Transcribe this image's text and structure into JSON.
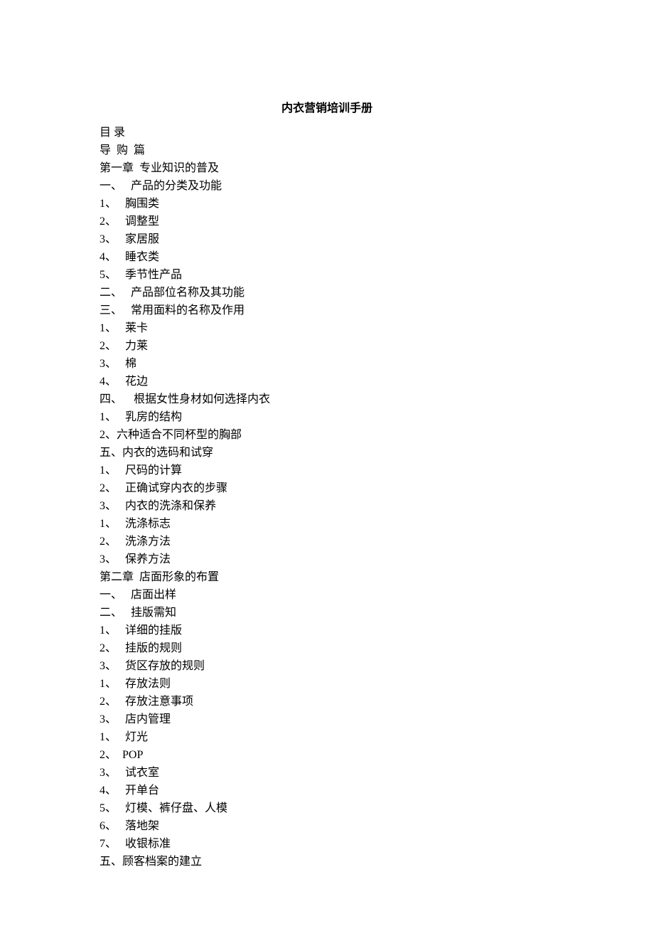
{
  "title": "内衣营销培训手册",
  "lines": [
    "目 录",
    "导  购  篇",
    "第一章  专业知识的普及",
    "一、   产品的分类及功能",
    "1、   胸围类",
    "2、   调整型",
    "3、   家居服",
    "4、   睡衣类",
    "5、   季节性产品",
    "二、   产品部位名称及其功能",
    "三、   常用面料的名称及作用",
    "1、   莱卡",
    "2、   力莱",
    "3、   棉",
    "4、   花边",
    "四、    根据女性身材如何选择内衣",
    "1、   乳房的结构",
    "2、六种适合不同杯型的胸部",
    "五、内衣的选码和试穿",
    "1、   尺码的计算",
    "2、   正确试穿内衣的步骤",
    "3、   内衣的洗涤和保养",
    "1、   洗涤标志",
    "2、   洗涤方法",
    "3、   保养方法",
    "第二章  店面形象的布置",
    "一、   店面出样",
    "二、   挂版需知",
    "1、   详细的挂版",
    "2、   挂版的规则",
    "3、   货区存放的规则",
    "1、   存放法则",
    "2、   存放注意事项",
    "3、   店内管理",
    "1、   灯光",
    "2、  POP",
    "3、   试衣室",
    "4、   开单台",
    "5、   灯模、裤仔盘、人模",
    "6、   落地架",
    "7、   收银标准",
    "五、顾客档案的建立"
  ]
}
